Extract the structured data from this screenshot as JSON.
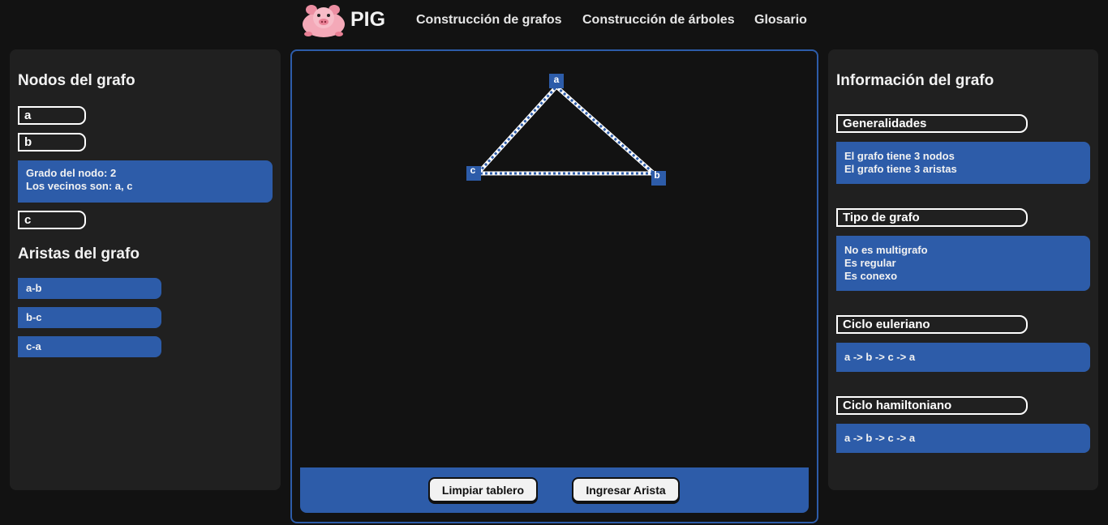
{
  "header": {
    "brand": "PIG",
    "nav": [
      {
        "label": "Construcción de grafos"
      },
      {
        "label": "Construcción de árboles"
      },
      {
        "label": "Glosario"
      }
    ]
  },
  "left_panel": {
    "nodes_title": "Nodos del grafo",
    "nodes": [
      {
        "label": "a"
      },
      {
        "label": "b"
      },
      {
        "label": "c"
      }
    ],
    "selected_node_info": {
      "degree": "Grado del nodo: 2",
      "neighbors": "Los vecinos son: a, c"
    },
    "edges_title": "Aristas del grafo",
    "edges": [
      {
        "label": "a-b"
      },
      {
        "label": "b-c"
      },
      {
        "label": "c-a"
      }
    ]
  },
  "board": {
    "node_labels": {
      "a": "a",
      "b": "b",
      "c": "c"
    },
    "buttons": {
      "clear": "Limpiar tablero",
      "add_edge": "Ingresar Arista"
    }
  },
  "right_panel": {
    "title": "Información del grafo",
    "sections": [
      {
        "title": "Generalidades",
        "lines": [
          "El grafo tiene 3 nodos",
          "El grafo tiene 3 aristas"
        ]
      },
      {
        "title": "Tipo de grafo",
        "lines": [
          "No es multigrafo",
          "Es regular",
          "Es conexo"
        ]
      },
      {
        "title": "Ciclo euleriano",
        "lines": [
          "a -> b -> c -> a"
        ]
      },
      {
        "title": "Ciclo hamiltoniano",
        "lines": [
          "a -> b -> c -> a"
        ]
      }
    ]
  },
  "colors": {
    "accent": "#2d5ca9",
    "background": "#121212",
    "panel": "#202020",
    "edge_dots": "#dfe8ff"
  }
}
